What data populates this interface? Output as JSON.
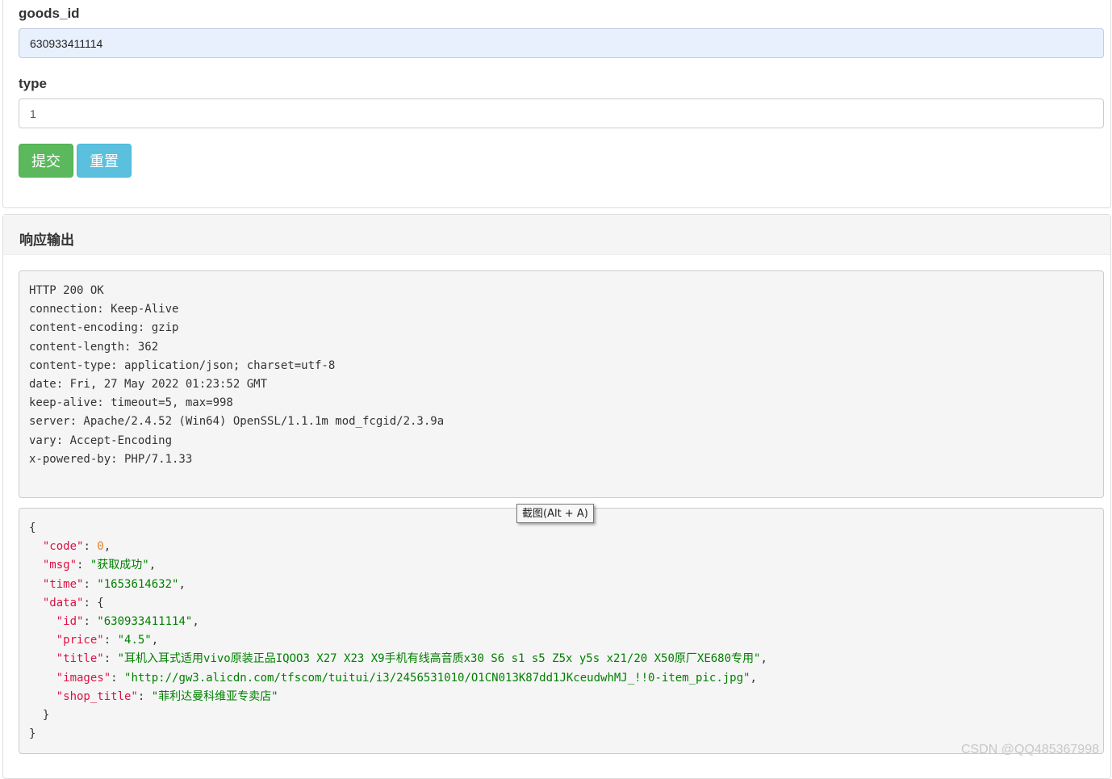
{
  "form": {
    "goods_id_label": "goods_id",
    "goods_id_value": "630933411114",
    "type_label": "type",
    "type_value": "1",
    "submit_label": "提交",
    "reset_label": "重置"
  },
  "response": {
    "title": "响应输出",
    "status_line": "HTTP 200 OK",
    "headers": [
      "connection: Keep-Alive",
      "content-encoding: gzip",
      "content-length: 362",
      "content-type: application/json; charset=utf-8",
      "date: Fri, 27 May 2022 01:23:52 GMT",
      "keep-alive: timeout=5, max=998",
      "server: Apache/2.4.52 (Win64) OpenSSL/1.1.1m mod_fcgid/2.3.9a",
      "vary: Accept-Encoding",
      "x-powered-by: PHP/7.1.33"
    ],
    "json": {
      "code_key": "\"code\"",
      "code_val": "0",
      "msg_key": "\"msg\"",
      "msg_val": "\"获取成功\"",
      "time_key": "\"time\"",
      "time_val": "\"1653614632\"",
      "data_key": "\"data\"",
      "id_key": "\"id\"",
      "id_val": "\"630933411114\"",
      "price_key": "\"price\"",
      "price_val": "\"4.5\"",
      "title_key": "\"title\"",
      "title_val": "\"耳机入耳式适用vivo原装正品IQOO3 X27 X23 X9手机有线高音质x30 S6 s1 s5 Z5x y5s x21/20 X50原厂XE680专用\"",
      "images_key": "\"images\"",
      "images_val": "\"http://gw3.alicdn.com/tfscom/tuitui/i3/2456531010/O1CN013K87dd1JKceudwhMJ_!!0-item_pic.jpg\"",
      "shop_title_key": "\"shop_title\"",
      "shop_title_val": "\"菲利达曼科维亚专卖店\""
    }
  },
  "tooltip": "截图(Alt + A)",
  "watermark": "CSDN @QQ485367998"
}
